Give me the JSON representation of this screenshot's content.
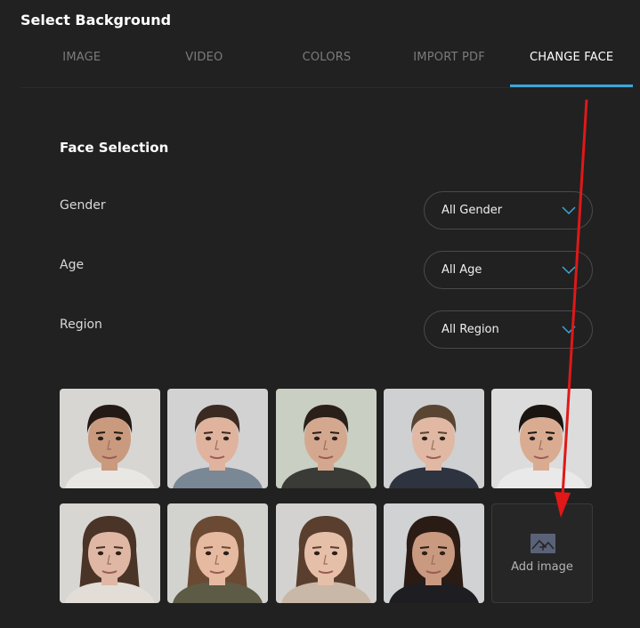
{
  "header": {
    "title": "Select Background"
  },
  "tabs": [
    {
      "label": "IMAGE"
    },
    {
      "label": "VIDEO"
    },
    {
      "label": "COLORS"
    },
    {
      "label": "IMPORT PDF"
    },
    {
      "label": "CHANGE FACE",
      "active": true
    }
  ],
  "face_selection": {
    "title": "Face Selection",
    "filters": {
      "gender": {
        "label": "Gender",
        "value": "All Gender"
      },
      "age": {
        "label": "Age",
        "value": "All Age"
      },
      "region": {
        "label": "Region",
        "value": "All Region"
      }
    }
  },
  "faces": [
    {
      "name": "face-1",
      "bg": "#d8d6d3",
      "skin": "#c99a7e",
      "hair": "#231a16",
      "shirt": "#e9e7e3",
      "long_hair": false
    },
    {
      "name": "face-2",
      "bg": "#d3d2d3",
      "skin": "#e0b39e",
      "hair": "#3a2a22",
      "shirt": "#7a8794",
      "long_hair": false
    },
    {
      "name": "face-3",
      "bg": "#c9cfc2",
      "skin": "#d4a88f",
      "hair": "#2a2019",
      "shirt": "#3a3a36",
      "long_hair": false
    },
    {
      "name": "face-4",
      "bg": "#cfd0d2",
      "skin": "#e0b8a3",
      "hair": "#5a4533",
      "shirt": "#2e3340",
      "long_hair": false
    },
    {
      "name": "face-5",
      "bg": "#dcdcdc",
      "skin": "#d9ac92",
      "hair": "#1b1512",
      "shirt": "#e9e9e9",
      "long_hair": false
    },
    {
      "name": "face-6",
      "bg": "#d8d6d2",
      "skin": "#dfb7a4",
      "hair": "#4a3427",
      "shirt": "#e2ddd6",
      "long_hair": true
    },
    {
      "name": "face-7",
      "bg": "#d2d2cf",
      "skin": "#e6b9a1",
      "hair": "#6b4a33",
      "shirt": "#5d5a45",
      "long_hair": true
    },
    {
      "name": "face-8",
      "bg": "#d4d2d0",
      "skin": "#e6bfa9",
      "hair": "#5a3f2e",
      "shirt": "#c9b7a7",
      "long_hair": true
    },
    {
      "name": "face-9",
      "bg": "#d0d2d4",
      "skin": "#c99980",
      "hair": "#2a1c15",
      "shirt": "#1e1e22",
      "long_hair": true
    }
  ],
  "add_image": {
    "label": "Add image",
    "icon": "image-add-icon"
  },
  "annotation": {
    "color": "#e01818"
  }
}
